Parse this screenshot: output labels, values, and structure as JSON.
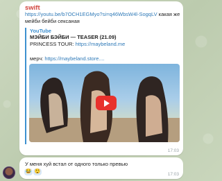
{
  "messages": [
    {
      "sender": "swift",
      "text_link": "https://youtu.be/b7OCH1EGMyo?si=q46WbsW4l-SogqLV",
      "text_rest": " какая же мейби бейби сексаная",
      "preview": {
        "site": "YouTube",
        "title": "МЭЙБИ БЭЙБИ — TEASER (21.09)",
        "line1_prefix": "PRINCESS TOUR: ",
        "line1_link": "https://maybeland.me",
        "line2_prefix": "мерч: ",
        "line2_link": "https://maybeland.store...."
      },
      "time": "17:03"
    },
    {
      "text": "У меня хуй встал от одного только превью",
      "reaction_icons": [
        "😂",
        "😲"
      ],
      "time": "17:03"
    }
  ],
  "colors": {
    "sender": "#d1443c",
    "link": "#2f7ab8",
    "accent": "#3d90d0",
    "play": "#e8312c"
  },
  "icons": [
    "play-icon",
    "avatar"
  ]
}
